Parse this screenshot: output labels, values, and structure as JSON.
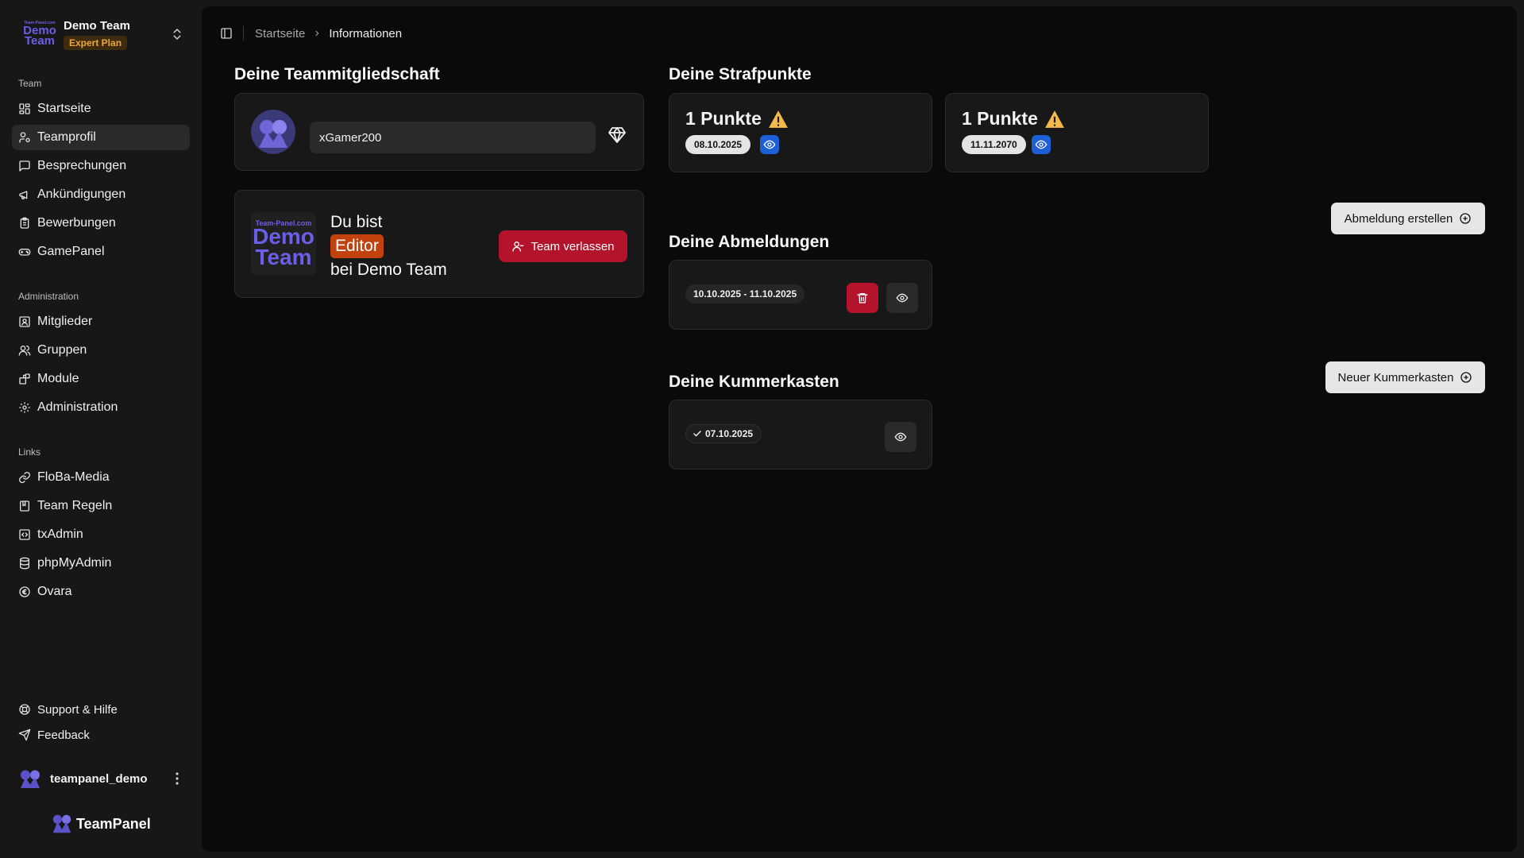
{
  "sidebar": {
    "team": {
      "name": "Demo Team",
      "plan": "Expert Plan",
      "logo_small": "Team-Panel.com",
      "logo_line1": "Demo",
      "logo_line2": "Team"
    },
    "sections": {
      "team": "Team",
      "administration": "Administration",
      "links": "Links"
    },
    "team_items": [
      {
        "label": "Startseite",
        "icon": "dashboard-icon"
      },
      {
        "label": "Teamprofil",
        "icon": "user-cog-icon",
        "active": true
      },
      {
        "label": "Besprechungen",
        "icon": "message-square-icon"
      },
      {
        "label": "Ankündigungen",
        "icon": "megaphone-icon"
      },
      {
        "label": "Bewerbungen",
        "icon": "clipboard-icon"
      },
      {
        "label": "GamePanel",
        "icon": "gamepad-icon"
      }
    ],
    "admin_items": [
      {
        "label": "Mitglieder",
        "icon": "contact-icon"
      },
      {
        "label": "Gruppen",
        "icon": "users-icon"
      },
      {
        "label": "Module",
        "icon": "blocks-icon"
      },
      {
        "label": "Administration",
        "icon": "settings-icon"
      }
    ],
    "link_items": [
      {
        "label": "FloBa-Media",
        "icon": "link-icon"
      },
      {
        "label": "Team Regeln",
        "icon": "book-icon"
      },
      {
        "label": "txAdmin",
        "icon": "code-icon"
      },
      {
        "label": "phpMyAdmin",
        "icon": "database-icon"
      },
      {
        "label": "Ovara",
        "icon": "euro-icon"
      }
    ],
    "footer_items": [
      {
        "label": "Support & Hilfe",
        "icon": "lifebuoy-icon"
      },
      {
        "label": "Feedback",
        "icon": "send-icon"
      }
    ],
    "user": {
      "name": "teampanel_demo"
    },
    "brand": "TeamPanel"
  },
  "header": {
    "breadcrumb": [
      "Startseite",
      "Informationen"
    ]
  },
  "membership": {
    "title": "Deine Teammitgliedschaft",
    "username": "xGamer200",
    "role_prefix": "Du bist",
    "role": "Editor",
    "role_suffix": "bei Demo Team",
    "leave_label": "Team verlassen",
    "logo_small": "Team-Panel.com",
    "logo_line1": "Demo",
    "logo_line2": "Team"
  },
  "penalties": {
    "title": "Deine Strafpunkte",
    "items": [
      {
        "points": "1 Punkte",
        "date": "08.10.2025"
      },
      {
        "points": "1 Punkte",
        "date": "11.11.2070"
      }
    ]
  },
  "absences": {
    "title": "Deine Abmeldungen",
    "create_label": "Abmeldung erstellen",
    "items": [
      {
        "range": "10.10.2025 - 11.10.2025"
      }
    ]
  },
  "grievances": {
    "title": "Deine Kummerkasten",
    "create_label": "Neuer Kummerkasten",
    "items": [
      {
        "date": "07.10.2025"
      }
    ]
  },
  "colors": {
    "accent_blue": "#1d5fd6",
    "danger_red": "#b3142b",
    "plan_orange": "#f0a53b",
    "role_orange": "#c2410c",
    "warning_yellow": "#f5b94a",
    "logo_purple": "#6b5fe8"
  }
}
